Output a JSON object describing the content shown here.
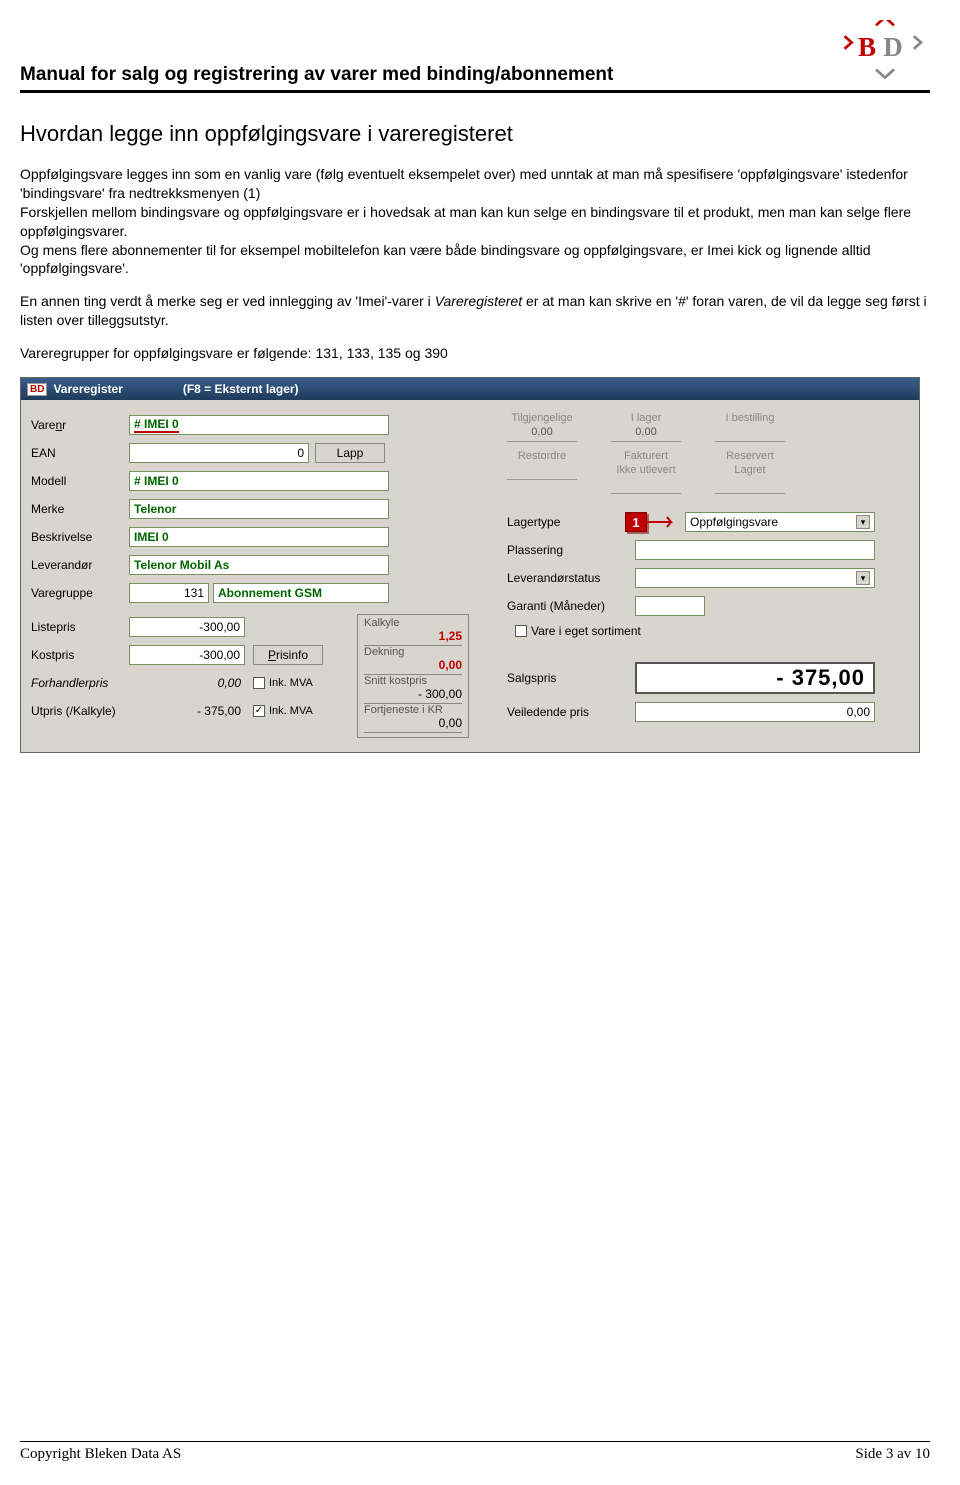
{
  "header": {
    "title": "Manual for salg og registrering av varer med binding/abonnement"
  },
  "section_title": "Hvordan legge inn oppfølgingsvare i vareregisteret",
  "para1": "Oppfølgingsvare legges inn som en vanlig vare (følg eventuelt eksempelet over) med unntak at man må spesifisere 'oppfølgingsvare' istedenfor 'bindingsvare' fra nedtrekksmenyen (1)",
  "para2": "Forskjellen mellom bindingsvare og oppfølgingsvare er i hovedsak at man kan kun selge en bindingsvare til et produkt, men man kan selge flere oppfølgingsvarer.",
  "para3": "Og mens flere abonnementer til for eksempel mobiltelefon kan være både bindingsvare og oppfølgingsvare, er Imei kick og lignende alltid 'oppfølgingsvare'.",
  "para4a": "En annen ting verdt å merke seg er ved innlegging av 'Imei'-varer i ",
  "para4_em": "Vareregisteret",
  "para4b": " er at man kan skrive en '#' foran varen, de vil da legge seg først i listen over tilleggsutstyr.",
  "para5": "Vareregrupper for oppfølgingsvare er følgende: 131,  133,  135 og 390",
  "app": {
    "titlebar_icon": "BD",
    "titlebar_text": "Vareregister",
    "titlebar_sub": "(F8 = Eksternt lager)",
    "left": {
      "varenr_label": "Varenr",
      "varenr_value": "# IMEI 0",
      "ean_label": "EAN",
      "ean_value": "0",
      "lapp_btn": "Lapp",
      "modell_label": "Modell",
      "modell_value": "# IMEI 0",
      "merke_label": "Merke",
      "merke_value": "Telenor",
      "beskrivelse_label": "Beskrivelse",
      "beskrivelse_value": "IMEI 0",
      "leverandor_label": "Leverandør",
      "leverandor_value": "Telenor Mobil As",
      "varegruppe_label": "Varegruppe",
      "varegruppe_code": "131",
      "varegruppe_text": "Abonnement GSM",
      "listepris_label": "Listepris",
      "listepris_value": "-300,00",
      "kostpris_label": "Kostpris",
      "kostpris_value": "-300,00",
      "prisinfo_btn": "Prisinfo",
      "forhandlerpris_label": "Forhandlerpris",
      "forhandlerpris_value": "0,00",
      "inkmva_label": "Ink. MVA",
      "utpris_label": "Utpris (/Kalkyle)",
      "utpris_value": "- 375,00",
      "kalkyle_label": "Kalkyle",
      "kalkyle_value": "1,25",
      "dekning_label": "Dekning",
      "dekning_value": "0,00",
      "snitt_label": "Snitt kostpris",
      "snitt_value": "- 300,00",
      "fortjeneste_label": "Fortjeneste i KR",
      "fortjeneste_value": "0,00"
    },
    "right": {
      "tilgjengelige_label": "Tilgjengelige",
      "tilgjengelige_value": "0,00",
      "ilager_label": "I lager",
      "ilager_value": "0,00",
      "ibestilling_label": "I bestilling",
      "restordre_label": "Restordre",
      "fakturert_label": "Fakturert",
      "ikke_utlevert_label": "Ikke utlevert",
      "reservert_label": "Reservert",
      "lagret_label": "Lagret",
      "lagertype_label": "Lagertype",
      "lagertype_value": "Oppfølgingsvare",
      "badge": "1",
      "plassering_label": "Plassering",
      "leverandorstatus_label": "Leverandørstatus",
      "garanti_label": "Garanti (Måneder)",
      "vare_eget_label": "Vare i eget sortiment",
      "salgspris_label": "Salgspris",
      "salgspris_value": "- 375,00",
      "veiledende_label": "Veiledende pris",
      "veiledende_value": "0,00"
    }
  },
  "footer": {
    "copyright": "Copyright Bleken Data AS",
    "page": "Side 3 av 10"
  }
}
